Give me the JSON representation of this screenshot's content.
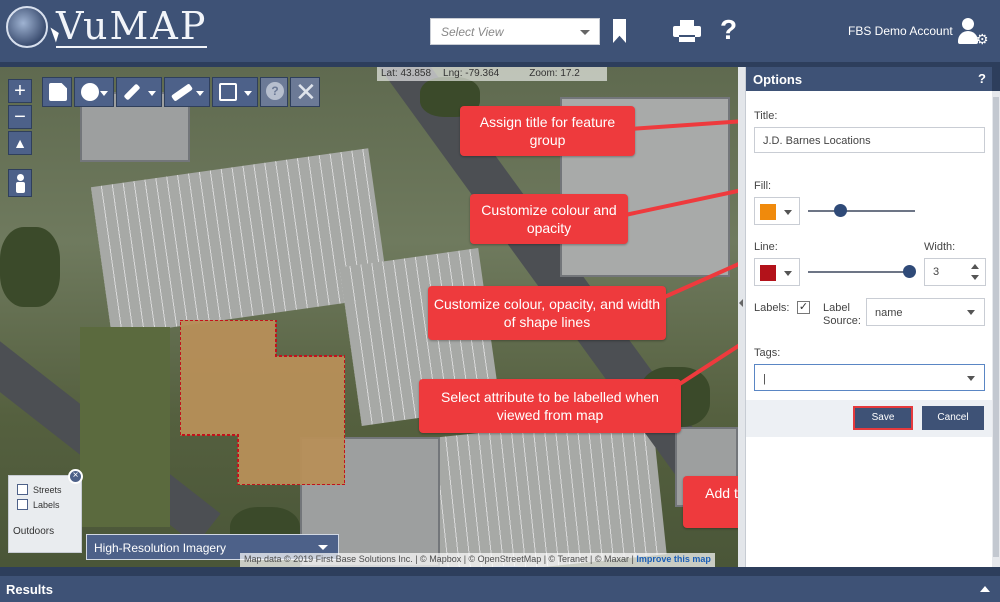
{
  "header": {
    "logo_text": "VuMAP",
    "select_view_placeholder": "Select View",
    "account_name": "FBS Demo Account"
  },
  "map": {
    "lat_label": "Lat: 43.858",
    "lng_label": "Lng: -79.364",
    "zoom_label": "Zoom: 17.2",
    "zoom_in": "+",
    "zoom_out": "−",
    "layers": {
      "streets": "Streets",
      "labels": "Labels",
      "style": "Outdoors"
    },
    "basemap_value": "High-Resolution Imagery",
    "attribution_text": "Map data © 2019 First Base Solutions Inc. | © Mapbox | © OpenStreetMap | © Teranet | © Maxar |",
    "attribution_link": "Improve this map"
  },
  "callouts": [
    {
      "id": "title",
      "text": "Assign title for feature group"
    },
    {
      "id": "fill",
      "text": "Customize colour and opacity"
    },
    {
      "id": "line",
      "text": "Customize colour, opacity, and width of shape lines"
    },
    {
      "id": "labels",
      "text": "Select attribute to be labelled when viewed from map"
    },
    {
      "id": "tags",
      "text": "Add tags to categroize features (e.g. project number, date)"
    }
  ],
  "options": {
    "heading": "Options",
    "help": "?",
    "title_label": "Title:",
    "title_value": "J.D. Barnes Locations",
    "fill_label": "Fill:",
    "fill_color": "#f08a0c",
    "fill_opacity": 0.3,
    "line_label": "Line:",
    "line_color": "#b3121a",
    "line_opacity": 0.95,
    "width_label": "Width:",
    "width_value": "3",
    "labels_label": "Labels:",
    "labels_checked": "✓",
    "label_source_label": "Label Source:",
    "label_source_value": "name",
    "tags_label": "Tags:",
    "tags_value": "|",
    "save": "Save",
    "cancel": "Cancel"
  },
  "results": {
    "heading": "Results"
  },
  "colors": {
    "header_bg": "#3e5276",
    "callout": "#ee3a3d",
    "accent": "#2f4a78"
  }
}
